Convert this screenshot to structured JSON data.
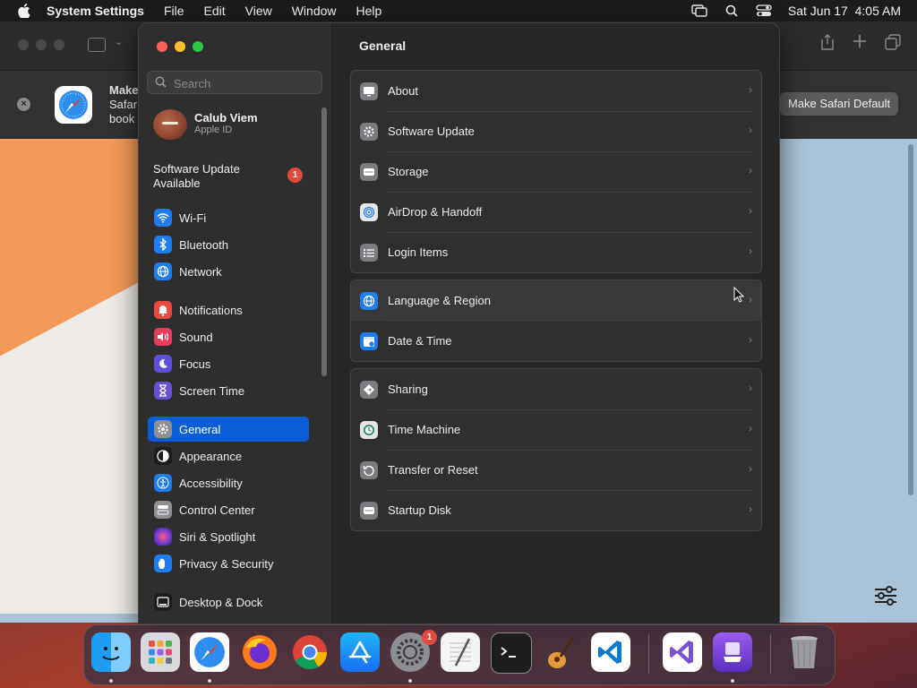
{
  "menubar": {
    "app_name": "System Settings",
    "menus": [
      "File",
      "Edit",
      "View",
      "Window",
      "Help"
    ],
    "clock": "Sat Jun 17  4:05 AM"
  },
  "safari": {
    "banner_title": "Make",
    "banner_line2": "Safar",
    "banner_line3": "book",
    "make_default_label": "Make Safari Default"
  },
  "settings": {
    "search_placeholder": "Search",
    "account": {
      "name": "Calub Viem",
      "subtitle": "Apple ID"
    },
    "update_notice": {
      "line1": "Software Update",
      "line2": "Available",
      "badge": "1"
    },
    "sidebar": [
      {
        "label": "Wi-Fi",
        "icon": "wifi-icon",
        "color": "#1f7cf0"
      },
      {
        "label": "Bluetooth",
        "icon": "bluetooth-icon",
        "color": "#1f7cf0"
      },
      {
        "label": "Network",
        "icon": "globe-icon",
        "color": "#1f7cf0"
      },
      {
        "label": "Notifications",
        "icon": "bell-icon",
        "color": "#e5483c"
      },
      {
        "label": "Sound",
        "icon": "speaker-icon",
        "color": "#e53d5a"
      },
      {
        "label": "Focus",
        "icon": "moon-icon",
        "color": "#5e4fd8"
      },
      {
        "label": "Screen Time",
        "icon": "hourglass-icon",
        "color": "#6a4fd8"
      },
      {
        "label": "General",
        "icon": "gear-icon",
        "color": "#8e8e93"
      },
      {
        "label": "Appearance",
        "icon": "appearance-icon",
        "color": "#1c1c1c"
      },
      {
        "label": "Accessibility",
        "icon": "accessibility-icon",
        "color": "#1f7cf0"
      },
      {
        "label": "Control Center",
        "icon": "control-center-icon",
        "color": "#8e8e93"
      },
      {
        "label": "Siri & Spotlight",
        "icon": "siri-icon",
        "color": "#b03aa0"
      },
      {
        "label": "Privacy & Security",
        "icon": "hand-icon",
        "color": "#1f7cf0"
      },
      {
        "label": "Desktop & Dock",
        "icon": "dock-icon",
        "color": "#1c1c1c"
      }
    ],
    "active_item": "General",
    "title": "General",
    "groups": [
      [
        {
          "label": "About",
          "icon": "display-icon"
        },
        {
          "label": "Software Update",
          "icon": "gear-badge-icon"
        },
        {
          "label": "Storage",
          "icon": "drive-icon"
        },
        {
          "label": "AirDrop & Handoff",
          "icon": "airdrop-icon"
        },
        {
          "label": "Login Items",
          "icon": "list-icon"
        }
      ],
      [
        {
          "label": "Language & Region",
          "icon": "globe-icon"
        },
        {
          "label": "Date & Time",
          "icon": "calendar-clock-icon"
        }
      ],
      [
        {
          "label": "Sharing",
          "icon": "sharing-icon"
        },
        {
          "label": "Time Machine",
          "icon": "time-machine-icon"
        },
        {
          "label": "Transfer or Reset",
          "icon": "reset-icon"
        },
        {
          "label": "Startup Disk",
          "icon": "disk-icon"
        }
      ]
    ]
  },
  "dock": {
    "apps": [
      "Finder",
      "Launchpad",
      "Safari",
      "Firefox",
      "Chrome",
      "App Store",
      "System Settings",
      "TextEdit",
      "Terminal",
      "GarageBand",
      "Visual Studio Code",
      "Visual Studio",
      "Apple Configurator",
      "Trash"
    ],
    "settings_badge": "1"
  }
}
